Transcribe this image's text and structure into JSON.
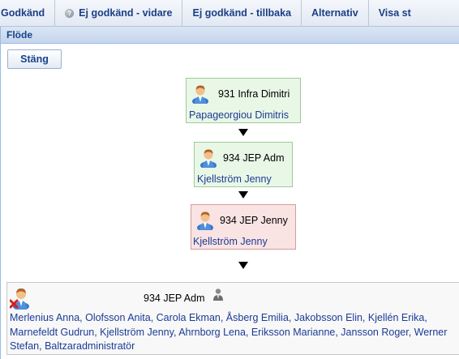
{
  "toolbar": {
    "items": [
      {
        "label": "Godkänd",
        "icon": ""
      },
      {
        "label": "Ej godkänd - vidare",
        "icon": "help-icon"
      },
      {
        "label": "Ej godkänd - tillbaka",
        "icon": ""
      },
      {
        "label": "Alternativ",
        "icon": ""
      },
      {
        "label": "Visa st",
        "icon": ""
      }
    ]
  },
  "panel": {
    "title": "Flöde",
    "close_label": "Stäng"
  },
  "flow": {
    "nodes": [
      {
        "title": "931 Infra Dimitri",
        "person": "Papageorgiou Dimitris",
        "status": "approved",
        "status_color": "#e9f7e6"
      },
      {
        "title": "934 JEP Adm",
        "person": "Kjellström Jenny",
        "status": "approved",
        "status_color": "#e9f7e6"
      },
      {
        "title": "934 JEP Jenny",
        "person": "Kjellström Jenny",
        "status": "rejected",
        "status_color": "#fae3e3"
      }
    ],
    "group": {
      "title": "934 JEP Adm",
      "icon": "user-remove-icon",
      "title_icon": "user-group-icon",
      "members": "Merlenius Anna, Olofsson Anita, Carola Ekman, Åsberg Emilia, Jakobsson Elin, Kjellén Erika, Marnefeldt Gudrun, Kjellström Jenny, Ahrnborg Lena, Eriksson Marianne, Jansson Roger, Werner Stefan, Baltzaradministratör"
    }
  }
}
